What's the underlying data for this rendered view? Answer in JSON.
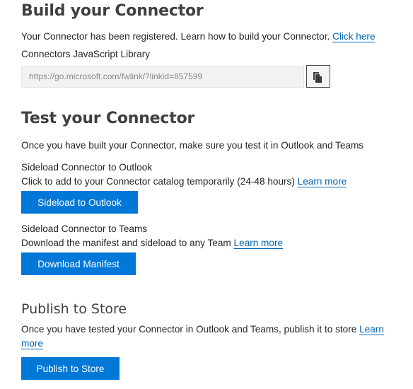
{
  "build": {
    "title": "Build your Connector",
    "registered_text": "Your Connector has been registered. Learn how to build your Connector.",
    "click_here_link": "Click here",
    "library_label": "Connectors JavaScript Library",
    "library_url_value": "https://go.microsoft.com/fwlink/?linkid=857599",
    "copy_icon": "copy-icon"
  },
  "test": {
    "title": "Test your Connector",
    "intro_text": "Once you have built your Connector, make sure you test it in Outlook and Teams",
    "outlook_heading": "Sideload Connector to Outlook",
    "outlook_desc": "Click to add to your Connector catalog temporarily (24-48 hours)",
    "outlook_learn_more": "Learn more",
    "outlook_button": "Sideload to Outlook",
    "teams_heading": "Sideload Connector to Teams",
    "teams_desc": "Download the manifest and sideload to any Team",
    "teams_learn_more": "Learn more",
    "teams_button": "Download Manifest"
  },
  "publish": {
    "title": "Publish to Store",
    "desc": "Once you have tested your Connector in Outlook and Teams, publish it to store",
    "learn_more_1": "Learn",
    "learn_more_2": "more",
    "button": "Publish to Store"
  },
  "colors": {
    "accent": "#0078d7",
    "link": "#0063b1",
    "heading": "#404040",
    "text": "#262626"
  }
}
